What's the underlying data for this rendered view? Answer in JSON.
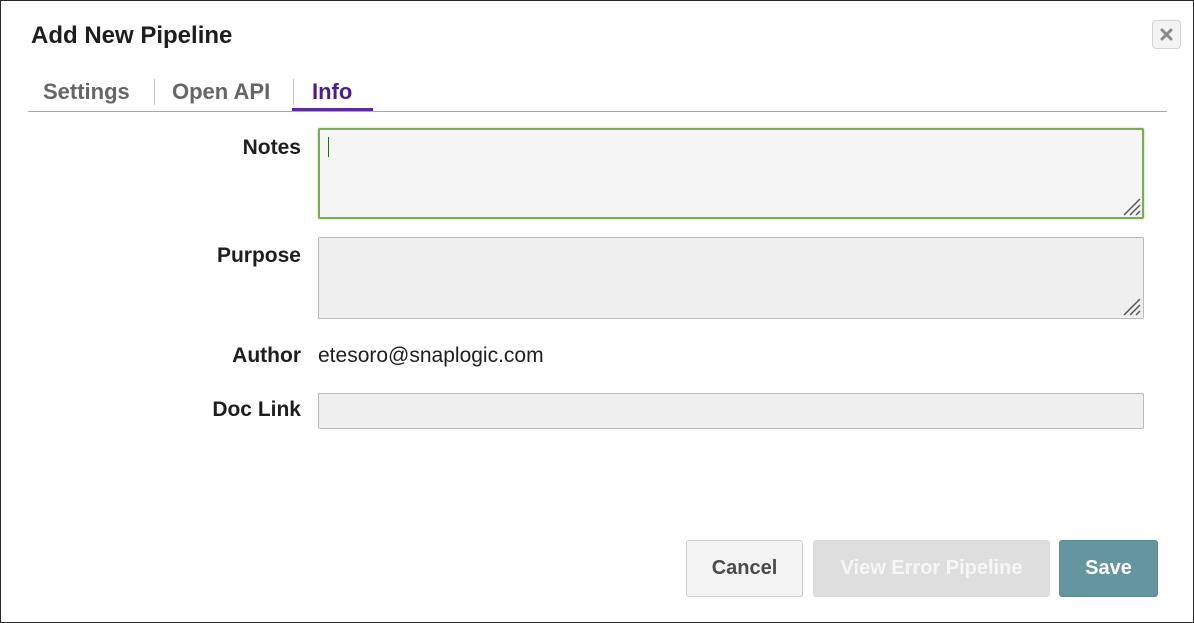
{
  "dialog": {
    "title": "Add New Pipeline",
    "close_icon": "close-x-icon"
  },
  "tabs": [
    {
      "label": "Settings",
      "active": false
    },
    {
      "label": "Open API",
      "active": false
    },
    {
      "label": "Info",
      "active": true
    }
  ],
  "form": {
    "notes": {
      "label": "Notes",
      "value": "",
      "focused": true
    },
    "purpose": {
      "label": "Purpose",
      "value": ""
    },
    "author": {
      "label": "Author",
      "value": "etesoro@snaplogic.com"
    },
    "doc_link": {
      "label": "Doc Link",
      "value": ""
    }
  },
  "footer": {
    "cancel_label": "Cancel",
    "view_error_label": "View Error Pipeline",
    "save_label": "Save"
  },
  "colors": {
    "active_tab": "#4b1d8c",
    "focus_border": "#7aab59",
    "save_button": "#6596a0",
    "disabled_button": "#dedede"
  }
}
